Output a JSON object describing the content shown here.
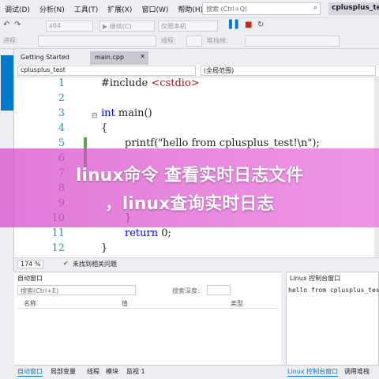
{
  "menu": [
    "调试(D)",
    "分析(N)",
    "工具(T)",
    "扩展(X)",
    "窗口(W)",
    "帮助(H)"
  ],
  "search": {
    "placeholder": "搜索 (Ctrl+Q)"
  },
  "project_name": "cplusplus_test",
  "toolbar1": {
    "platform": "x64",
    "debugger": "▶ 继续(C)",
    "cpu": "仅限本机"
  },
  "toolbar2": {
    "process_label": "进程:",
    "thread_label": "线程:",
    "stack_label": "堆栈帧:"
  },
  "doc_tabs": {
    "getting_started": "Getting Started",
    "active": "main.cpp"
  },
  "nav": {
    "project": "cplusplus_test",
    "scope": "(全局范围)"
  },
  "code": {
    "line_numbers": [
      "1",
      "2",
      "3",
      "4",
      "5",
      "6",
      "7",
      "8",
      "9",
      "10",
      "11",
      "12"
    ],
    "include_kw": "#include",
    "include_target": "<cstdio>",
    "int_kw": "int",
    "main_sig": " main()",
    "open_brace": "{",
    "printf_line": "printf(\"hello from cplusplus_test!\\n\");",
    "return_kw": "return",
    "return_val": " 0;",
    "close_brace": "}",
    "inner_close": "}"
  },
  "status": {
    "zoom": "174 %",
    "issues": "未找到相关问题"
  },
  "autos": {
    "title": "自动窗口",
    "search_placeholder": "搜索(Ctrl+E)",
    "search_depth": "搜索深度:",
    "col_name": "名称",
    "col_value": "值",
    "col_type": "类型"
  },
  "console": {
    "title": "Linux 控制台窗口",
    "output": "hello from cplusplus_tes"
  },
  "bottom_tabs": {
    "autos": "自动窗口",
    "locals": "局部变量",
    "threads": "线程",
    "modules": "模块",
    "watch": "监视 1",
    "console": "Linux 控制台窗口",
    "callstack": "调用堆栈"
  },
  "overlay": {
    "line1": "linux命令 查看实时日志文件",
    "line2": "，linux查询实时日志"
  },
  "colors": {
    "accent": "#007acc",
    "keyword": "#0000ff",
    "string": "#a31515",
    "line_number": "#2b91af",
    "overlay": "#d646c8"
  }
}
